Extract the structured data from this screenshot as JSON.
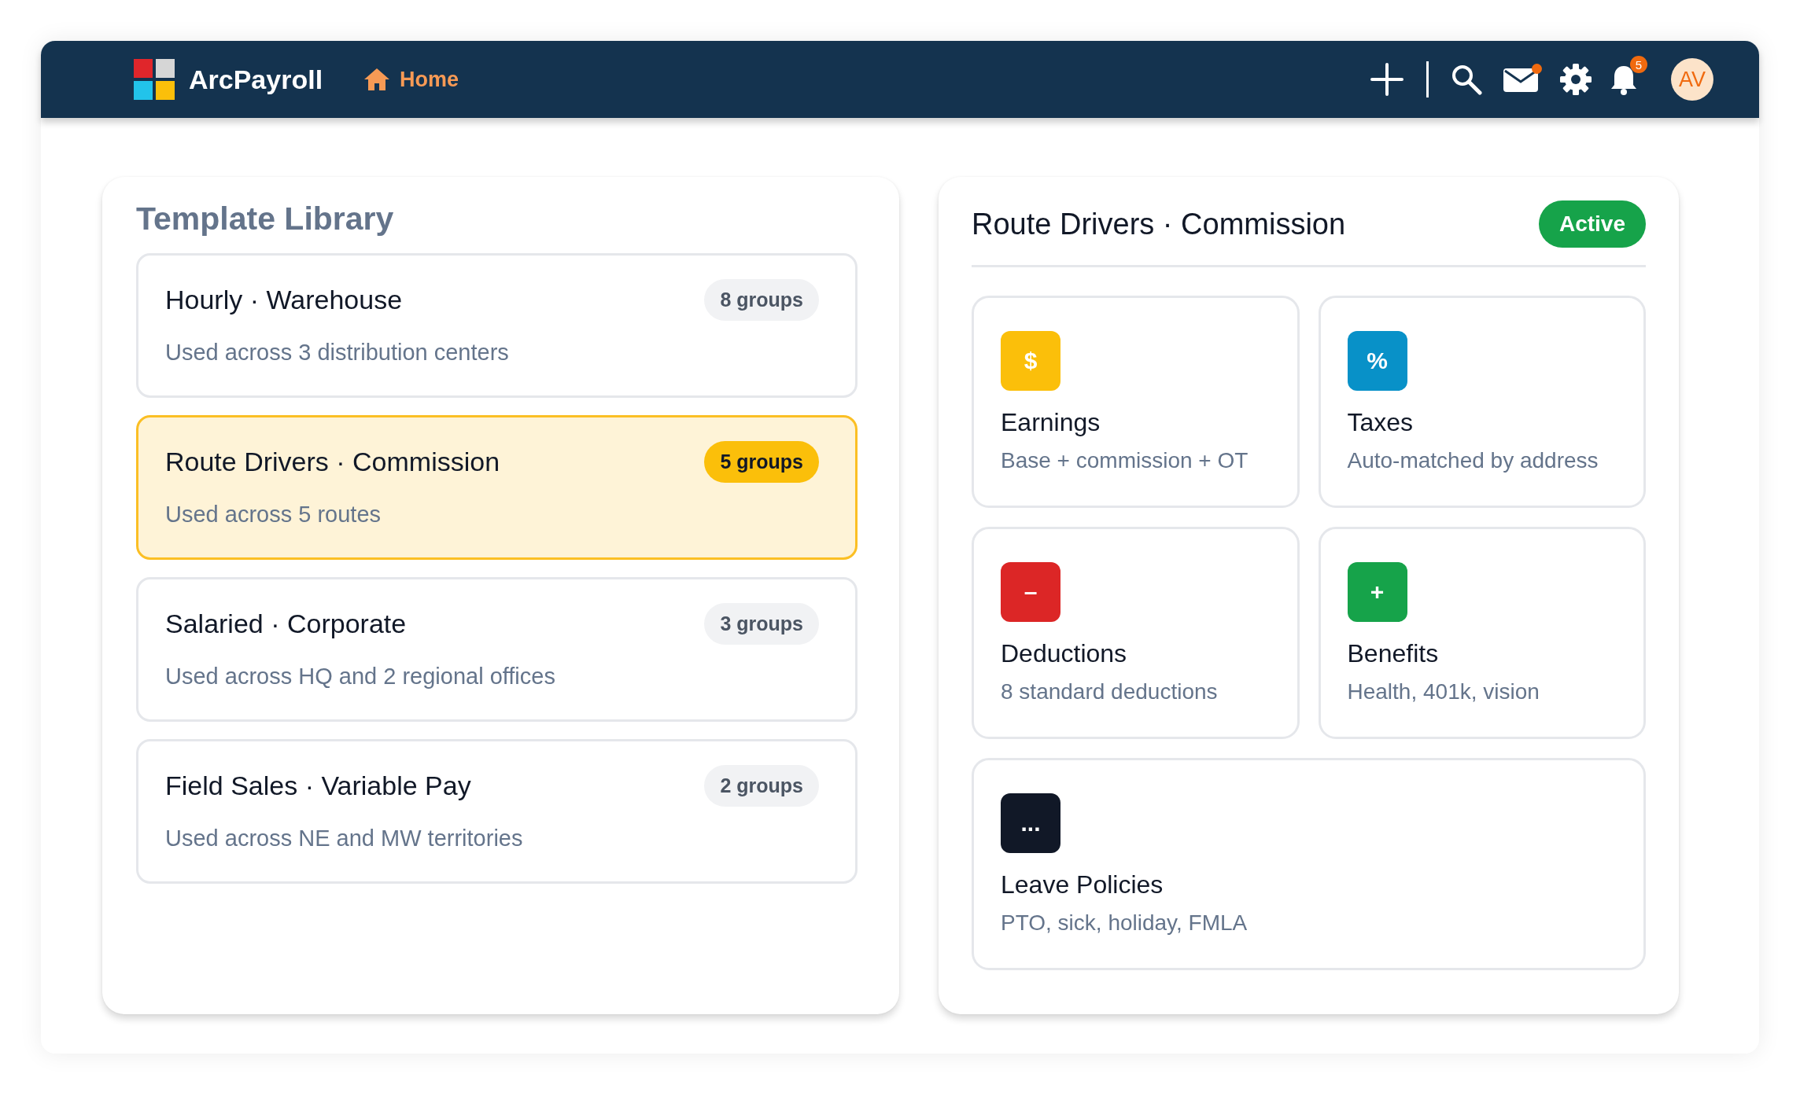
{
  "app": {
    "name": "ArcPayroll"
  },
  "nav": {
    "label": "Home"
  },
  "toolbar": {
    "mail_unread": true,
    "notifications": "5",
    "avatar": "AV"
  },
  "library": {
    "title": "Template Library",
    "templates": [
      {
        "name": "Hourly · Warehouse",
        "groups": "8 groups",
        "usage": "Used across 3 distribution centers",
        "selected": false
      },
      {
        "name": "Route Drivers · Commission",
        "groups": "5 groups",
        "usage": "Used across 5 routes",
        "selected": true
      },
      {
        "name": "Salaried · Corporate",
        "groups": "3 groups",
        "usage": "Used across HQ and 2 regional offices",
        "selected": false
      },
      {
        "name": "Field Sales · Variable Pay",
        "groups": "2 groups",
        "usage": "Used across NE and MW territories",
        "selected": false
      }
    ]
  },
  "detail": {
    "title": "Route Drivers · Commission",
    "status": "Active",
    "sections": [
      {
        "icon": "$",
        "color": "#fbbf0a",
        "title": "Earnings",
        "description": "Base + commission + OT"
      },
      {
        "icon": "%",
        "color": "#0891c8",
        "title": "Taxes",
        "description": "Auto-matched by address"
      },
      {
        "icon": "–",
        "color": "#dc2626",
        "title": "Deductions",
        "description": "8 standard deductions"
      },
      {
        "icon": "+",
        "color": "#16a34a",
        "title": "Benefits",
        "description": "Health, 401k, vision"
      },
      {
        "icon": "...",
        "color": "#111827",
        "title": "Leave Policies",
        "description": "PTO, sick, holiday, FMLA"
      }
    ]
  }
}
